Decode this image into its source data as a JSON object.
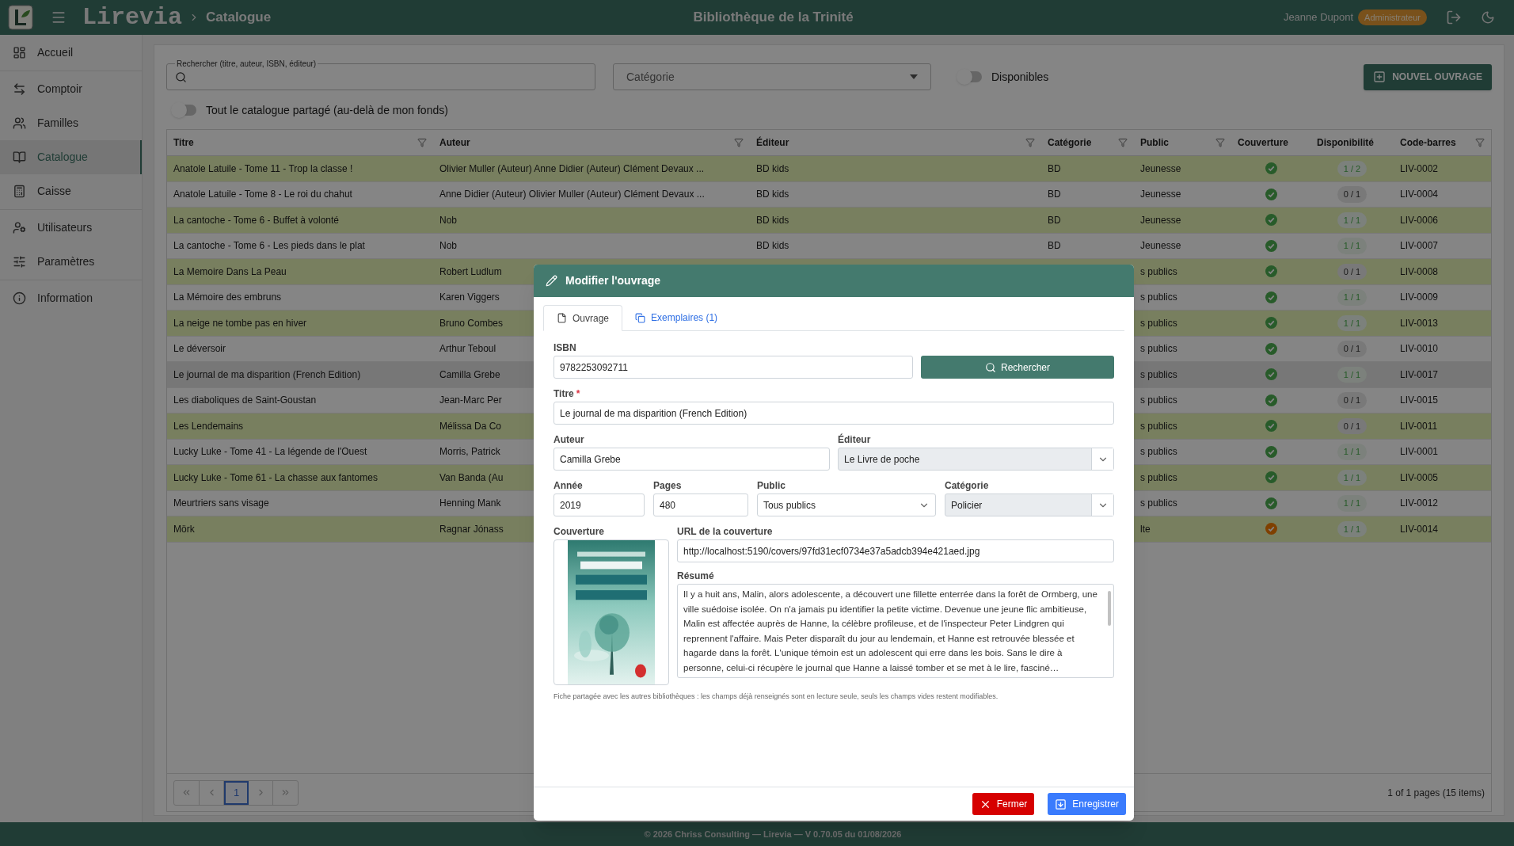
{
  "topbar": {
    "app_name": "Lirevia",
    "breadcrumb": "Catalogue",
    "library": "Bibliothèque de la Trinité",
    "user": "Jeanne Dupont",
    "role": "Administrateur"
  },
  "sidebar": {
    "groups": [
      {
        "items": [
          {
            "label": "Accueil",
            "selected": false
          }
        ]
      },
      {
        "items": [
          {
            "label": "Comptoir",
            "selected": false
          },
          {
            "label": "Familles",
            "selected": false
          },
          {
            "label": "Catalogue",
            "selected": true
          },
          {
            "label": "Caisse",
            "selected": false
          }
        ]
      },
      {
        "items": [
          {
            "label": "Utilisateurs",
            "selected": false
          },
          {
            "label": "Paramètres",
            "selected": false
          }
        ]
      },
      {
        "items": [
          {
            "label": "Information",
            "selected": false
          }
        ]
      }
    ]
  },
  "filters": {
    "search": {
      "label": "Rechercher (titre, auteur, ISBN, éditeur)"
    },
    "category": {
      "placeholder": "Catégorie"
    },
    "available_toggle": {
      "label": "Disponibles",
      "on": false
    },
    "new_button": "NOUVEL OUVRAGE",
    "shared_toggle": {
      "label": "Tout le catalogue partagé (au-delà de mon fonds)",
      "on": false
    }
  },
  "table": {
    "columns": [
      {
        "label": "Titre",
        "filter": true
      },
      {
        "label": "Auteur",
        "filter": true
      },
      {
        "label": "Éditeur",
        "filter": true
      },
      {
        "label": "Catégorie",
        "filter": true
      },
      {
        "label": "Public",
        "filter": true
      },
      {
        "label": "Couverture",
        "filter": false
      },
      {
        "label": "Disponibilité",
        "filter": false
      },
      {
        "label": "Code-barres",
        "filter": true
      }
    ],
    "rows": [
      {
        "title": "Anatole Latuile - Tome 11 - Trop la classe !",
        "author": "Olivier Muller (Auteur) Anne Didier (Auteur) Clément Devaux ...",
        "publisher": "BD kids",
        "category": "BD",
        "audience": "Jeunesse",
        "color": "#285b2a",
        "availability": "1 / 2",
        "available": true,
        "barcode": "LIV-0002",
        "selected": false
      },
      {
        "title": "Anatole Latuile - Tome 8 - Le roi du chahut",
        "author": "Anne Didier (Auteur) Olivier Muller (Auteur) Clément Devaux ...",
        "publisher": "BD kids",
        "category": "BD",
        "audience": "Jeunesse",
        "color": "#285b2a",
        "availability": "0 / 1",
        "available": false,
        "barcode": "LIV-0004",
        "selected": false
      },
      {
        "title": "La cantoche - Tome 6 - Buffet à volonté",
        "author": "Nob",
        "publisher": "BD kids",
        "category": "BD",
        "audience": "Jeunesse",
        "color": "#285b2a",
        "availability": "1 / 1",
        "available": true,
        "barcode": "LIV-0006",
        "selected": false
      },
      {
        "title": "La cantoche - Tome 6 - Les pieds dans le plat",
        "author": "Nob",
        "publisher": "BD kids",
        "category": "BD",
        "audience": "Jeunesse",
        "color": "#285b2a",
        "availability": "1 / 1",
        "available": true,
        "barcode": "LIV-0007",
        "selected": false
      },
      {
        "title": "La Memoire Dans La Peau",
        "author": "Robert Ludlum",
        "audience": "s publics",
        "color": "#285b2a",
        "availability": "0 / 1",
        "available": false,
        "barcode": "LIV-0008",
        "selected": false
      },
      {
        "title": "La Mémoire des embruns",
        "author": "Karen Viggers",
        "audience": "s publics",
        "color": "#285b2a",
        "availability": "1 / 1",
        "available": true,
        "barcode": "LIV-0009",
        "selected": false
      },
      {
        "title": "La neige ne tombe pas en hiver",
        "author": "Bruno Combes",
        "audience": "s publics",
        "color": "#285b2a",
        "availability": "1 / 1",
        "available": true,
        "barcode": "LIV-0013",
        "selected": false
      },
      {
        "title": "Le déversoir",
        "author": "Arthur Teboul",
        "audience": "s publics",
        "color": "#285b2a",
        "availability": "0 / 1",
        "available": false,
        "barcode": "LIV-0010",
        "selected": false
      },
      {
        "title": "Le journal de ma disparition (French Edition)",
        "author": "Camilla Grebe",
        "audience": "s publics",
        "color": "#285b2a",
        "availability": "1 / 1",
        "available": true,
        "barcode": "LIV-0017",
        "selected": true
      },
      {
        "title": "Les diaboliques de Saint-Goustan",
        "author": "Jean-Marc Per",
        "audience": "s publics",
        "color": "#285b2a",
        "availability": "0 / 1",
        "available": false,
        "barcode": "LIV-0015",
        "selected": false
      },
      {
        "title": "Les Lendemains",
        "author": "Mélissa Da Co",
        "audience": "s publics",
        "color": "#285b2a",
        "availability": "0 / 1",
        "available": false,
        "barcode": "LIV-0011",
        "selected": false
      },
      {
        "title": "Lucky Luke - Tome 41 - La légende de l'Ouest",
        "author": "Morris, Patrick",
        "audience": "s publics",
        "color": "#285b2a",
        "availability": "1 / 1",
        "available": true,
        "barcode": "LIV-0001",
        "selected": false
      },
      {
        "title": "Lucky Luke - Tome 61 - La chasse aux fantomes",
        "author": "Van Banda (Au",
        "audience": "s publics",
        "color": "#285b2a",
        "availability": "1 / 1",
        "available": true,
        "barcode": "LIV-0005",
        "selected": false
      },
      {
        "title": "Meurtriers sans visage",
        "author": "Henning Mank",
        "audience": "s publics",
        "color": "#285b2a",
        "availability": "1 / 1",
        "available": true,
        "barcode": "LIV-0012",
        "selected": false
      },
      {
        "title": "Mörk",
        "author": "Ragnar Jónass",
        "audience": "lte",
        "color": "#7f4000",
        "availability": "1 / 1",
        "available": true,
        "barcode": "LIV-0014",
        "selected": false
      }
    ]
  },
  "pagination": {
    "pages": [
      {
        "label": "1",
        "selected": true
      }
    ],
    "summary": "1 of 1 pages (15 items)"
  },
  "modal": {
    "title": "Modifier l'ouvrage",
    "tabs": [
      {
        "label": "Ouvrage",
        "selected": true
      },
      {
        "label": "Exemplaires (1)",
        "selected": false
      }
    ],
    "isbn": {
      "label": "ISBN",
      "value": "9782253092711"
    },
    "search_button": "Rechercher",
    "title_field": {
      "label": "Titre",
      "value": "Le journal de ma disparition (French Edition)",
      "required_mark": "*"
    },
    "author": {
      "label": "Auteur",
      "value": "Camilla Grebe"
    },
    "publisher": {
      "label": "Éditeur",
      "value": "Le Livre de poche",
      "kind": "select",
      "disabled": true
    },
    "year": {
      "label": "Année",
      "value": "2019"
    },
    "pages": {
      "label": "Pages",
      "value": "480"
    },
    "audience": {
      "label": "Public",
      "value": "Tous publics",
      "kind": "select",
      "disabled": false
    },
    "category": {
      "label": "Catégorie",
      "value": "Policier",
      "kind": "select",
      "disabled": true
    },
    "cover": {
      "label": "Couverture",
      "kind": "picture"
    },
    "cover_url": {
      "label": "URL de la couverture",
      "value": "http://localhost:5190/covers/97fd31ecf0734e37a5adcb394e421aed.jpg"
    },
    "summary": {
      "label": "Résumé",
      "value": "Il y a huit ans, Malin, alors adolescente, a découvert une fillette enterrée dans la forêt de Ormberg, une ville suédoise isolée. On n'a jamais pu identifier la petite victime. Devenue une jeune flic ambitieuse, Malin est affectée auprès de Hanne, la célèbre profileuse, et de l'inspecteur Peter Lindgren qui reprennent l'affaire. Mais Peter disparaît du jour au lendemain, et Hanne est retrouvée blessée et hagarde dans la forêt. L'unique témoin est un adolescent qui erre dans les bois. Sans le dire à personne, celui-ci récupère le journal que Hanne a laissé tomber et se met à le lire, fasciné…"
    },
    "note": "Fiche partagée avec les autres bibliothèques : les champs déjà renseignés sont en lecture seule, seuls les champs vides restent modifiables.",
    "close_button": "Fermer",
    "save_button": "Enregistrer"
  },
  "footer": "© 2026 Chriss Consulting — Lirevia — V 0.70.05 du 01/08/2026"
}
